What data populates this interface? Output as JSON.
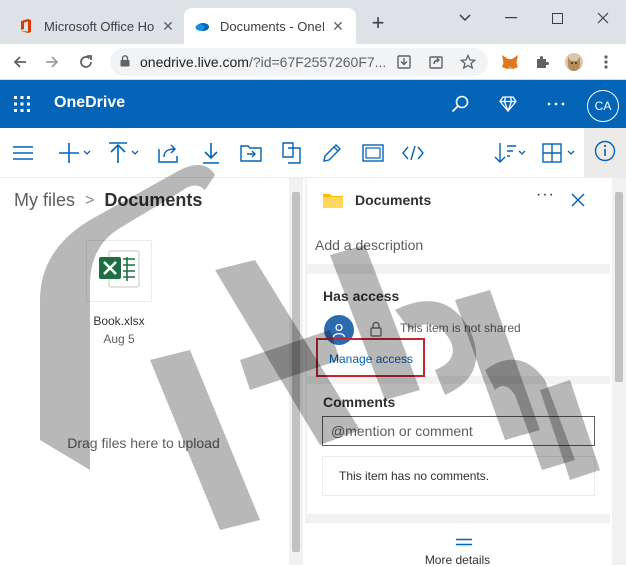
{
  "browser": {
    "tabs": [
      {
        "title": "Microsoft Office Hom",
        "active": false
      },
      {
        "title": "Documents - OneDri",
        "active": true
      }
    ],
    "new_tab_label": "+",
    "url_host": "onedrive.live.com",
    "url_path": "/?id=67F2557260F7..."
  },
  "onedrive": {
    "brand": "OneDrive",
    "avatar_initials": "CA"
  },
  "breadcrumb": {
    "root": "My files",
    "separator": ">",
    "current": "Documents"
  },
  "files": [
    {
      "name": "Book.xlsx",
      "date": "Aug 5"
    }
  ],
  "left_pane": {
    "drag_hint": "Drag files here to upload"
  },
  "details_panel": {
    "title": "Documents",
    "more_label": "···",
    "description_placeholder": "Add a description",
    "has_access_heading": "Has access",
    "sharing_status": "This item is not shared",
    "manage_access_link": "Manage access",
    "comments_heading": "Comments",
    "comment_placeholder": "@mention or comment",
    "no_comments": "This item has no comments.",
    "more_details": "More details"
  },
  "watermark_text": "Alphr",
  "colors": {
    "brand_blue": "#0364b8",
    "highlight_red": "#c4262e",
    "excel_green": "#1d6f42"
  }
}
